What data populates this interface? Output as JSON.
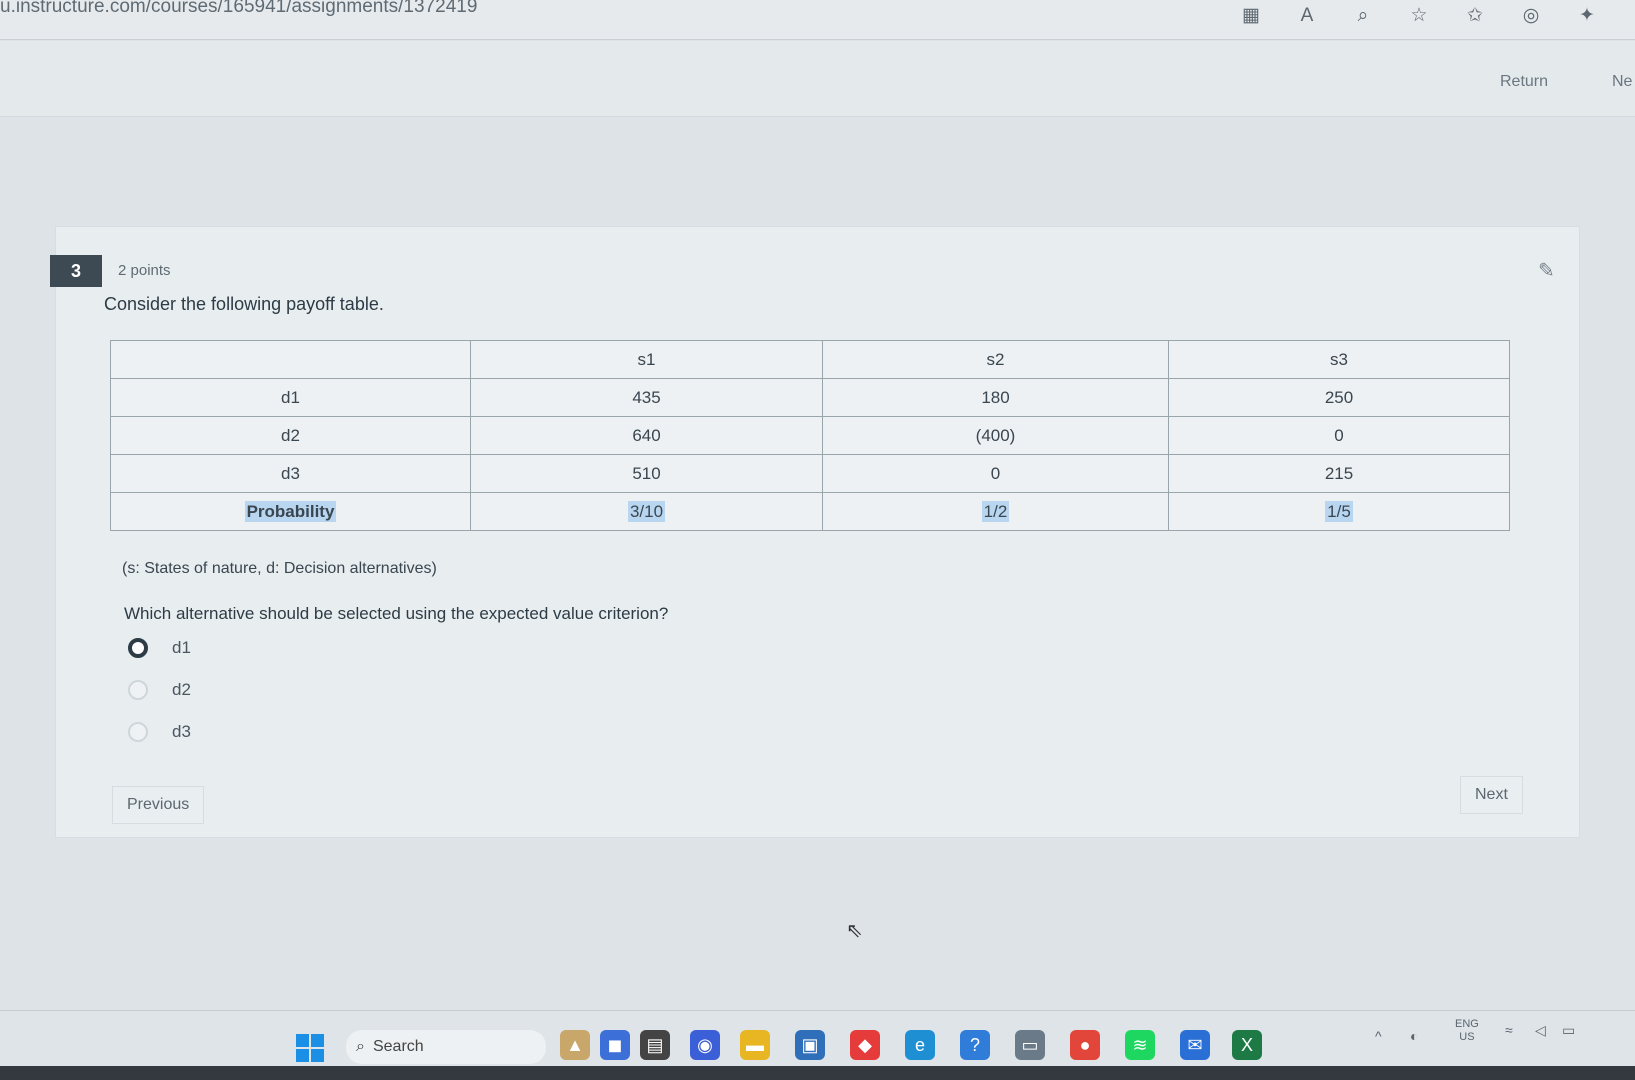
{
  "browser": {
    "url": "u.instructure.com/courses/165941/assignments/1372419"
  },
  "header": {
    "return_label": "Return",
    "next_label": "Ne"
  },
  "question": {
    "number": "3",
    "points": "2 points",
    "prompt": "Consider the following payoff table.",
    "table": {
      "headers": [
        "",
        "s1",
        "s2",
        "s3"
      ],
      "rows": [
        {
          "label": "d1",
          "values": [
            "435",
            "180",
            "250"
          ]
        },
        {
          "label": "d2",
          "values": [
            "640",
            "(400)",
            "0"
          ]
        },
        {
          "label": "d3",
          "values": [
            "510",
            "0",
            "215"
          ]
        },
        {
          "label": "Probability",
          "values": [
            "3/10",
            "1/2",
            "1/5"
          ]
        }
      ]
    },
    "legend": "(s: States of nature, d: Decision alternatives)",
    "question_text": "Which alternative should be selected using the expected value criterion?",
    "options": [
      {
        "label": "d1",
        "selected": true
      },
      {
        "label": "d2",
        "selected": false
      },
      {
        "label": "d3",
        "selected": false
      }
    ]
  },
  "nav": {
    "previous_label": "Previous",
    "next_label": "Next"
  },
  "taskbar": {
    "search_placeholder": "Search",
    "tray_lang": "ENG",
    "tray_region": "US"
  },
  "colors": {
    "accent": "#3d4a54",
    "highlight": "#b9d6f0",
    "windows_blue": "#1b8fe6"
  }
}
